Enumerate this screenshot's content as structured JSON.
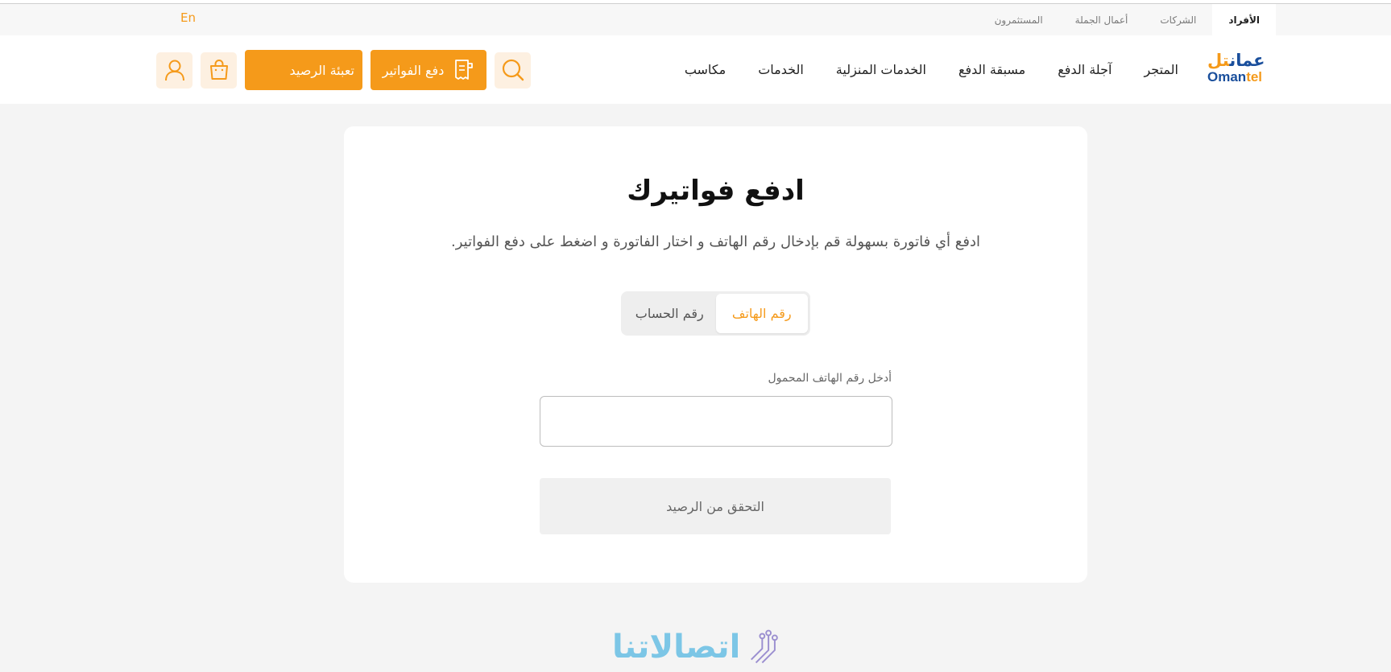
{
  "segments": {
    "tabs": [
      {
        "label": "الأفراد",
        "active": true
      },
      {
        "label": "الشركات",
        "active": false
      },
      {
        "label": "أعمال الجملة",
        "active": false
      },
      {
        "label": "المستثمرون",
        "active": false
      }
    ],
    "language": "En"
  },
  "logo": {
    "arabic_main": "عمان",
    "arabic_tail": "تل",
    "english_main": "Oman",
    "english_tail": "tel"
  },
  "nav": {
    "items": [
      "المتجر",
      "آجلة الدفع",
      "مسبقة الدفع",
      "الخدمات المنزلية",
      "الخدمات",
      "مكاسب"
    ]
  },
  "actions": {
    "pay_bills_label": "دفع الفواتير",
    "top_up_label": "تعبئة الرصيد",
    "icons": {
      "search": "search-icon",
      "bill": "receipt-icon",
      "bag": "shopping-bag-icon",
      "user": "user-icon"
    }
  },
  "card": {
    "title": "ادفع فواتيرك",
    "subtitle": "ادفع أي فاتورة بسهولة قم بإدخال رقم الهاتف و اختار الفاتورة و اضغط على دفع الفواتير.",
    "toggle": {
      "phone_label": "رقم الهاتف",
      "account_label": "رقم الحساب",
      "selected": "phone"
    },
    "field_label": "أدخل رقم الهاتف المحمول",
    "field_value": "",
    "check_button_label": "التحقق من الرصيد"
  },
  "watermark": {
    "text": "اتصالاتنا"
  },
  "colors": {
    "accent": "#f59a1a",
    "brand_blue": "#1a4f9c",
    "page_bg": "#f4f4f4",
    "watermark": "#7cc6e6"
  }
}
